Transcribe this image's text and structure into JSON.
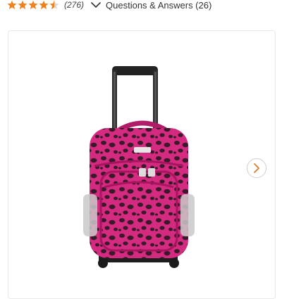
{
  "rating": {
    "value": 4.5,
    "max": 5,
    "star_color": "#f0821e",
    "review_count_label": "(276)"
  },
  "qa": {
    "label": "Questions & Answers (26)",
    "toggle_icon": "chevron-down-icon"
  },
  "product_image": {
    "alt": "Pink leopard print rolling backpack",
    "print_color": "#d42a7f",
    "spot_color": "#3a1a2a"
  },
  "carousel": {
    "next_icon": "chevron-right-icon",
    "accent": "#e07b2a"
  }
}
